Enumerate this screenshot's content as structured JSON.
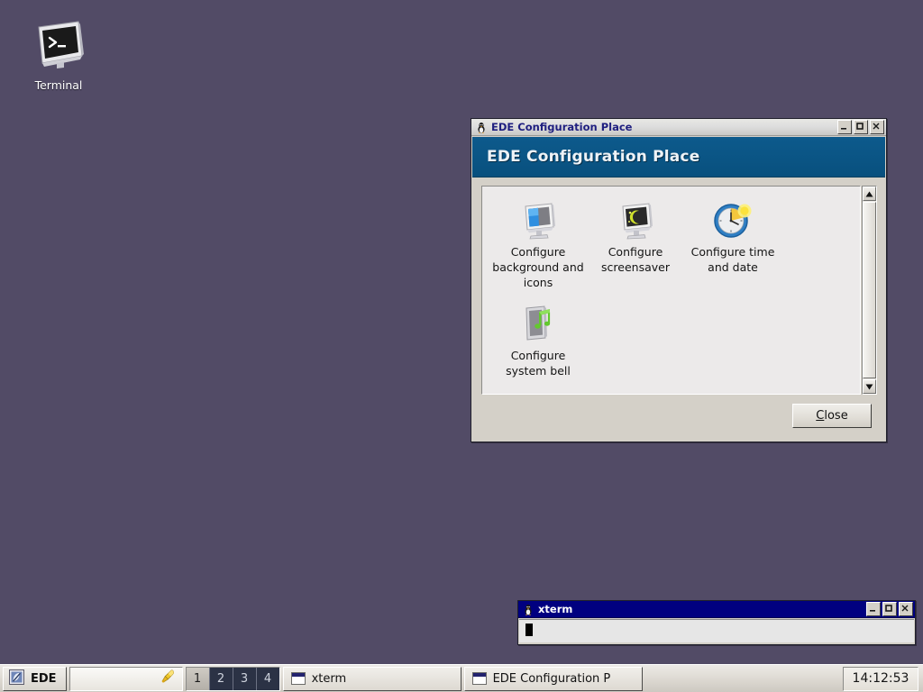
{
  "desktop": {
    "background_color": "#524b66",
    "icons": [
      {
        "label": "Terminal",
        "icon": "terminal-monitor-icon"
      }
    ]
  },
  "config_window": {
    "titlebar": {
      "icon": "tux-penguin-icon",
      "title": "EDE Configuration Place",
      "active": false,
      "buttons": [
        {
          "name": "minimize-button",
          "glyph": "_"
        },
        {
          "name": "maximize-button",
          "glyph": "□"
        },
        {
          "name": "close-button",
          "glyph": "×"
        }
      ]
    },
    "banner": {
      "heading": "EDE Configuration Place",
      "background_color": "#0b5483",
      "text_color": "#eef3f7"
    },
    "items": [
      {
        "label": "Configure background and icons",
        "icon": "monitor-wallpaper-icon"
      },
      {
        "label": "Configure screensaver",
        "icon": "monitor-moon-icon"
      },
      {
        "label": "Configure time and date",
        "icon": "clock-sun-icon"
      },
      {
        "label": "Configure system bell",
        "icon": "speaker-music-note-icon"
      }
    ],
    "scrollbar": {
      "up_arrow": "scroll-up-arrow-icon",
      "down_arrow": "scroll-down-arrow-icon"
    },
    "footer": {
      "close_label_pre": "C",
      "close_label_post": "lose"
    }
  },
  "xterm_window": {
    "titlebar": {
      "icon": "tux-penguin-icon",
      "title": "xterm",
      "active": true,
      "buttons": [
        {
          "name": "minimize-button",
          "glyph": "_"
        },
        {
          "name": "maximize-button",
          "glyph": "□"
        },
        {
          "name": "close-button",
          "glyph": "×"
        }
      ]
    }
  },
  "taskbar": {
    "start_button": {
      "label": "EDE",
      "icon": "ede-logo-icon"
    },
    "tray": {
      "icons": [
        {
          "name": "bell-icon"
        }
      ]
    },
    "pager": {
      "workspaces": [
        "1",
        "2",
        "3",
        "4"
      ],
      "active": "1"
    },
    "tasks": [
      {
        "label": "xterm",
        "icon": "window-mini-icon"
      },
      {
        "label": "EDE Configuration P",
        "icon": "window-mini-icon"
      }
    ],
    "clock": "14:12:53"
  }
}
